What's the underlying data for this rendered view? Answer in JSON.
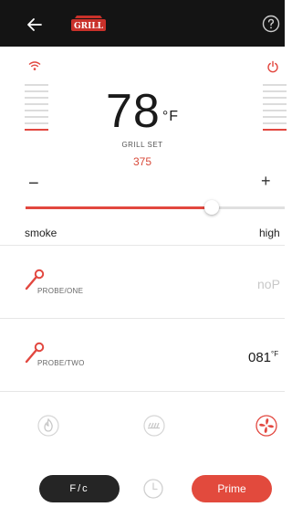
{
  "header": {
    "logo_text": "GRILL"
  },
  "grill": {
    "temperature": "78",
    "temp_unit": "°F",
    "set_label": "GRILL SET",
    "set_value": "375",
    "minus": "−",
    "plus": "+",
    "slider_fraction": 0.72,
    "smoke_label": "smoke",
    "high_label": "high"
  },
  "probes": [
    {
      "label": "PROBE/ONE",
      "value": "noP",
      "unit": ""
    },
    {
      "label": "PROBE/TWO",
      "value": "081",
      "unit": "°F"
    }
  ],
  "footer": {
    "fc_label": "F/c",
    "prime_label": "Prime"
  },
  "colors": {
    "accent": "#e24a3d",
    "header_bg": "#141414",
    "dark_button": "#252525"
  },
  "icons": [
    "back-arrow-icon",
    "grill-logo",
    "help-icon",
    "wifi-icon",
    "power-icon",
    "probe-icon",
    "flame-icon",
    "grill-grate-icon",
    "fan-icon",
    "clock-icon"
  ]
}
